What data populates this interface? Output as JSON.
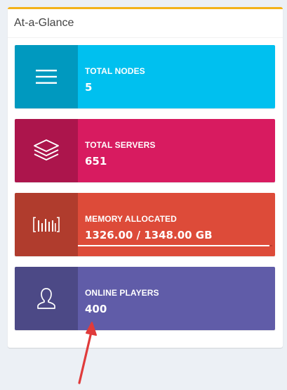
{
  "panel": {
    "title": "At-a-Glance",
    "accent_color": "#f3b21a"
  },
  "boxes": [
    {
      "label": "TOTAL NODES",
      "value": "5",
      "color": "#00c0ef",
      "icon": "bars-icon"
    },
    {
      "label": "TOTAL SERVERS",
      "value": "651",
      "color": "#d81b60",
      "icon": "layers-icon"
    },
    {
      "label": "MEMORY ALLOCATED",
      "value": "1326.00 / 1348.00 GB",
      "color": "#dd4b39",
      "icon": "memory-icon",
      "progress": 0.984
    },
    {
      "label": "ONLINE PLAYERS",
      "value": "400",
      "color": "#605ca8",
      "icon": "user-icon"
    }
  ],
  "annotation": {
    "arrow_color": "#e03b3b",
    "target": "online-players-value"
  }
}
